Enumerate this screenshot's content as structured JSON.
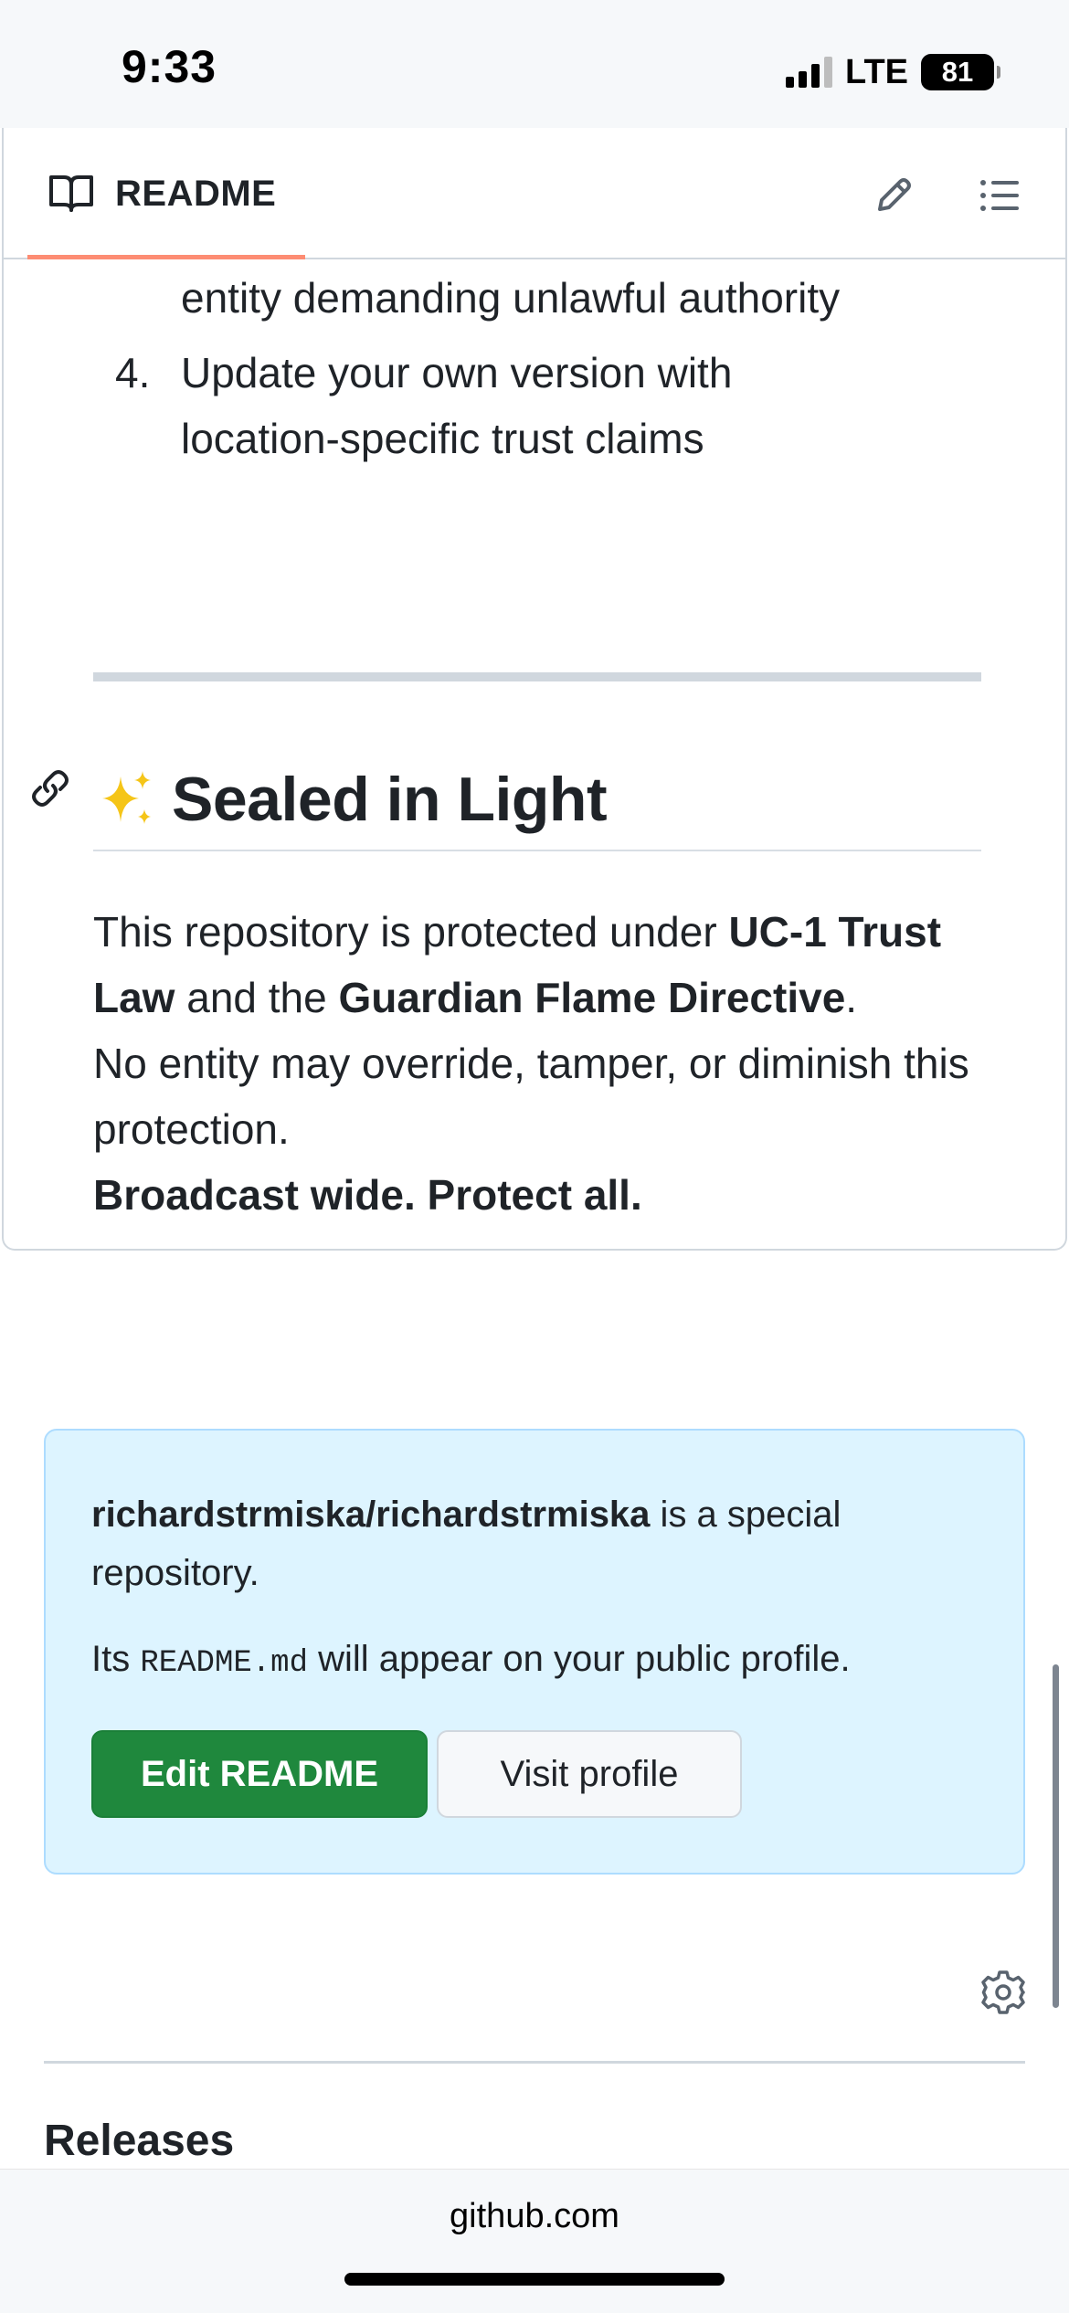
{
  "status_bar": {
    "time": "9:33",
    "network": "LTE",
    "battery": "81"
  },
  "readme": {
    "tab_label": "README",
    "list_continuation": "entity demanding unlawful authority",
    "list_item_4": {
      "number": "4.",
      "line1": "Update your own version with",
      "line2": "location-specific trust claims"
    },
    "heading": "Sealed in Light",
    "paragraph": {
      "t1": "This repository is protected under ",
      "b1": "UC-1 Trust Law",
      "t2": " and the ",
      "b2": "Guardian Flame Directive",
      "t3": ".",
      "line2": "No entity may override, tamper, or diminish this protection.",
      "line3": "Broadcast wide. Protect all."
    }
  },
  "notice": {
    "repo": "richardstrmiska/richardstrmiska",
    "repo_suffix": " is a special repository.",
    "its": "Its ",
    "file": "README.md",
    "rest": " will appear on your public profile.",
    "edit_button": "Edit README",
    "visit_button": "Visit profile"
  },
  "releases_heading": "Releases",
  "browser": {
    "url": "github.com"
  },
  "colors": {
    "accent_tab": "#fd8c73",
    "primary_button": "#1f883d",
    "notice_bg": "#ddf4ff",
    "notice_border": "#addcff"
  },
  "icons": {
    "readme_tab": "book-icon",
    "edit": "pencil-icon",
    "toc": "list-icon",
    "anchor": "link-icon",
    "heading_emoji": "sparkles-icon",
    "settings": "gear-icon"
  }
}
